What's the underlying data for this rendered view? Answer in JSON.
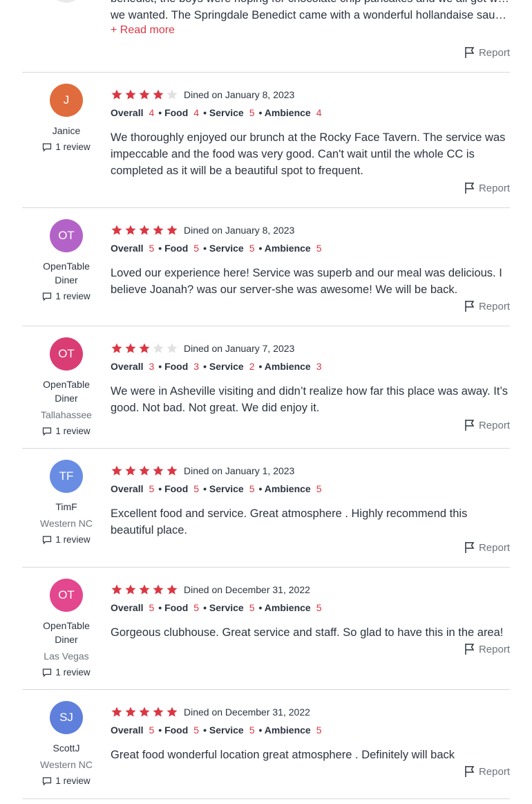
{
  "top_review": {
    "line1": "benedict, the boys were hoping for chocolate chip pancakes and we all got what",
    "line2": "we wanted. The Springdale Benedict came with a wonderful hollandaise sauce tha…",
    "read_more": "+ Read more",
    "report": "Report"
  },
  "review_count_label": "1 review",
  "report_label": "Report",
  "reviews": [
    {
      "initials": "J",
      "avatar_color": "#e06c3d",
      "name": "Janice",
      "location": "",
      "stars": 4,
      "dined": "Dined on January 8, 2023",
      "overall": "4",
      "food": "4",
      "service": "5",
      "ambience": "4",
      "text": "We thoroughly enjoyed our brunch at the Rocky Face Tavern. The service was impeccable and the food was very good. Can't wait until the whole CC is completed as it will be a beautiful spot to frequent."
    },
    {
      "initials": "OT",
      "avatar_color": "#b363c8",
      "name": "OpenTable Diner",
      "location": "",
      "stars": 5,
      "dined": "Dined on January 8, 2023",
      "overall": "5",
      "food": "5",
      "service": "5",
      "ambience": "5",
      "text": "Loved our experience here! Service was superb and our meal was delicious. I believe Joanah? was our server-she was awesome! We will be back."
    },
    {
      "initials": "OT",
      "avatar_color": "#da3d73",
      "name": "OpenTable Diner",
      "location": "Tallahassee",
      "stars": 3,
      "dined": "Dined on January 7, 2023",
      "overall": "3",
      "food": "3",
      "service": "2",
      "ambience": "3",
      "text": "We were in Asheville visiting and didn’t realize how far this place was away. It’s good. Not bad. Not great. We did enjoy it."
    },
    {
      "initials": "TF",
      "avatar_color": "#6a8de4",
      "name": "TimF",
      "location": "Western NC",
      "stars": 5,
      "dined": "Dined on January 1, 2023",
      "overall": "5",
      "food": "5",
      "service": "5",
      "ambience": "5",
      "text": "Excellent food and service. Great atmosphere . Highly recommend this beautiful place."
    },
    {
      "initials": "OT",
      "avatar_color": "#e3478e",
      "name": "OpenTable Diner",
      "location": "Las Vegas",
      "stars": 5,
      "dined": "Dined on December 31, 2022",
      "overall": "5",
      "food": "5",
      "service": "5",
      "ambience": "5",
      "text": "Gorgeous clubhouse. Great service and staff. So glad to have this in the area!"
    },
    {
      "initials": "SJ",
      "avatar_color": "#5f7fdc",
      "name": "ScottJ",
      "location": "Western NC",
      "stars": 5,
      "dined": "Dined on December 31, 2022",
      "overall": "5",
      "food": "5",
      "service": "5",
      "ambience": "5",
      "text": "Great food wonderful location great atmosphere . Definitely will back"
    }
  ],
  "labels": {
    "overall": "Overall",
    "food": "Food",
    "service": "Service",
    "ambience": "Ambience"
  },
  "colors": {
    "accent": "#da3743",
    "star_empty": "#e1e1e1"
  }
}
